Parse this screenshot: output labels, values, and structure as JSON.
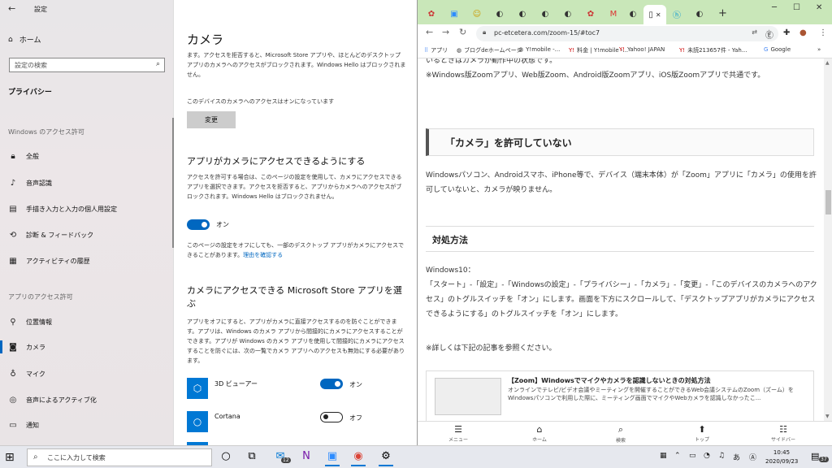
{
  "settings": {
    "app_title": "設定",
    "home": "ホーム",
    "search_placeholder": "設定の検索",
    "category": "プライバシー",
    "section_windows": "Windows のアクセス許可",
    "windows_items": [
      "全般",
      "音声認識",
      "手描き入力と入力の個人用設定",
      "診断 & フィードバック",
      "アクティビティの履歴"
    ],
    "section_apps": "アプリのアクセス許可",
    "app_items": [
      "位置情報",
      "カメラ",
      "マイク",
      "音声によるアクティブ化",
      "通知"
    ],
    "page_title": "カメラ",
    "intro_text": "ます。アクセスを拒否すると、Microsoft Store アプリや、ほとんどのデスクトップ アプリのカメラへのアクセスがブロックされます。Windows Hello はブロックされません。",
    "device_status": "このデバイスのカメラへのアクセスはオンになっています",
    "change_button": "変更",
    "allow_heading": "アプリがカメラにアクセスできるようにする",
    "allow_text": "アクセスを許可する場合は、このページの設定を使用して、カメラにアクセスできるアプリを選択できます。アクセスを拒否すると、アプリからカメラへのアクセスがブロックされます。Windows Hello はブロックされません。",
    "allow_toggle_state": "オン",
    "desktop_note": "このページの設定をオフにしても、一部のデスクトップ アプリがカメラにアクセスできることがあります。",
    "desktop_link": "理由を確認する",
    "store_heading": "カメラにアクセスできる Microsoft Store アプリを選ぶ",
    "store_text": "アプリをオフにすると、アプリがカメラに直接アクセスするのを防ぐことができます。アプリは、Windows のカメラ アプリから間接的にカメラにアクセスすることができます。アプリが Windows のカメラ アプリを使用して間接的にカメラにアクセスすることを防ぐには、次の一覧でカメラ アプリへのアクセスも無効にする必要があります。",
    "apps": [
      {
        "name": "3D ビューアー",
        "state": "オン",
        "on": true
      },
      {
        "name": "Cortana",
        "state": "オフ",
        "on": false
      }
    ]
  },
  "browser": {
    "url": "pc-etcetera.com/zoom-15/#toc7",
    "bookmarks": [
      "アプリ",
      "ブログdeホームページ",
      "Y!mobile -...",
      "料金 | Y!mobile -...",
      "Yahoo! JAPAN",
      "未読213657件 - Yah...",
      "Google"
    ],
    "top_text": "いるときはカメラが動作中の状態です。",
    "common_text": "※Windows版Zoomアプリ、Web版Zoom、Android版Zoomアプリ、iOS版Zoomアプリで共通です。",
    "heading": "「カメラ」を許可していない",
    "explain_text": "Windowsパソコン、Androidスマホ、iPhone等で、デバイス（端末本体）が「Zoom」アプリに「カメラ」の使用を許可していないと、カメラが映りません。",
    "fix_heading": "対処方法",
    "win10_label": "Windows10：",
    "steps_text": "「スタート」-「設定」-「Windowsの設定」-「プライバシー」-「カメラ」-「変更」-「このデバイスのカメラへのアクセス」のトグルスイッチを「オン」にします。画面を下方にスクロールして、「デスクトップアプリがカメラにアクセスできるようにする」のトグルスイッチを「オン」にします。",
    "detail_text": "※詳しくは下記の記事を参照ください。",
    "card_title": "【Zoom】Windowsでマイクやカメラを認識しないときの対処方法",
    "card_desc": "オンラインでテレビ/ビデオ会議やミーティングを開催することができるWeb会議システムのZoom（ズーム）をWindowsパソコンで利用した際に、ミーティング画面でマイクやWebカメラを認識しなかったこ...",
    "bottom_nav": [
      "メニュー",
      "ホーム",
      "検索",
      "トップ",
      "サイドバー"
    ]
  },
  "taskbar": {
    "search_placeholder": "ここに入力して検索",
    "mail_badge": "12",
    "time": "10:45",
    "date": "2020/09/23",
    "notification_count": "37"
  },
  "colors": {
    "accent": "#0067c0",
    "tabstrip": "#c9e7b9"
  }
}
